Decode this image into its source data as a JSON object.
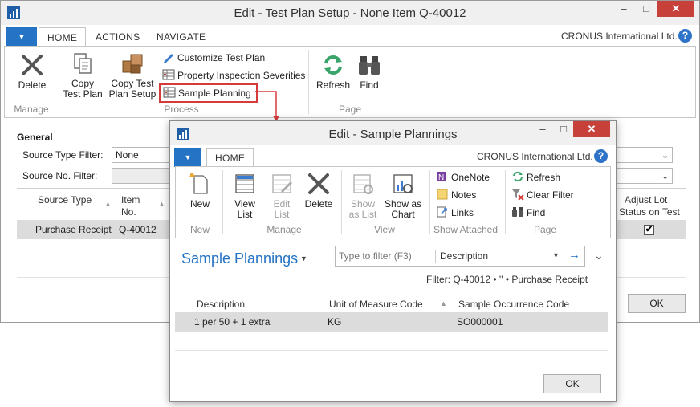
{
  "main": {
    "title": "Edit - Test Plan Setup - None   Item Q-40012",
    "company": "CRONUS International Ltd.",
    "tabs": [
      "HOME",
      "ACTIONS",
      "NAVIGATE"
    ],
    "ribbon": {
      "delete": "Delete",
      "copy_test_plan": "Copy Test Plan",
      "copy_test_plan_l1": "Copy",
      "copy_test_plan_l2": "Test Plan",
      "copy_setup_l1": "Copy Test",
      "copy_setup_l2": "Plan Setup",
      "customize": "Customize Test Plan",
      "property": "Property Inspection Severities",
      "sample_planning": "Sample Planning",
      "refresh": "Refresh",
      "find": "Find",
      "groups": [
        "Manage",
        "Process",
        "Page"
      ]
    },
    "general_label": "General",
    "source_type_filter_label": "Source Type Filter:",
    "source_type_filter_value": "None",
    "source_no_filter_label": "Source No. Filter:",
    "table": {
      "col_source_type": "Source Type",
      "col_item_l1": "Item",
      "col_item_l2": "No.",
      "col_adjust_l1": "Adjust Lot",
      "col_adjust_l2": "Status on Test",
      "rows": [
        {
          "source_type": "Purchase Receipt",
          "item_no": "Q-40012",
          "adjust": "✔"
        }
      ]
    },
    "ok": "OK"
  },
  "dialog": {
    "title": "Edit - Sample Plannings",
    "company": "CRONUS International Ltd.",
    "tab_home": "HOME",
    "ribbon": {
      "new": "New",
      "view_list_l1": "View",
      "view_list_l2": "List",
      "edit_list_l1": "Edit",
      "edit_list_l2": "List",
      "delete": "Delete",
      "show_as_list_l1": "Show",
      "show_as_list_l2": "as List",
      "show_as_chart_l1": "Show as",
      "show_as_chart_l2": "Chart",
      "onenote": "OneNote",
      "notes": "Notes",
      "links": "Links",
      "refresh": "Refresh",
      "clear_filter": "Clear Filter",
      "find": "Find",
      "groups": [
        "New",
        "Manage",
        "View",
        "Show Attached",
        "Page"
      ]
    },
    "page_title": "Sample Plannings",
    "filter_placeholder": "Type to filter (F3)",
    "filter_field": "Description",
    "filter_text": "Filter: Q-40012 • '' • Purchase Receipt",
    "columns": [
      "Description",
      "Unit of Measure Code",
      "Sample Occurrence Code"
    ],
    "rows": [
      {
        "description": "1 per 50 + 1 extra",
        "uom": "KG",
        "occurrence": "SO000001"
      }
    ],
    "ok": "OK"
  },
  "colors": {
    "accent": "#2473c4",
    "highlight_border": "#d63b3b",
    "selected_row": "#dcdcdc"
  }
}
